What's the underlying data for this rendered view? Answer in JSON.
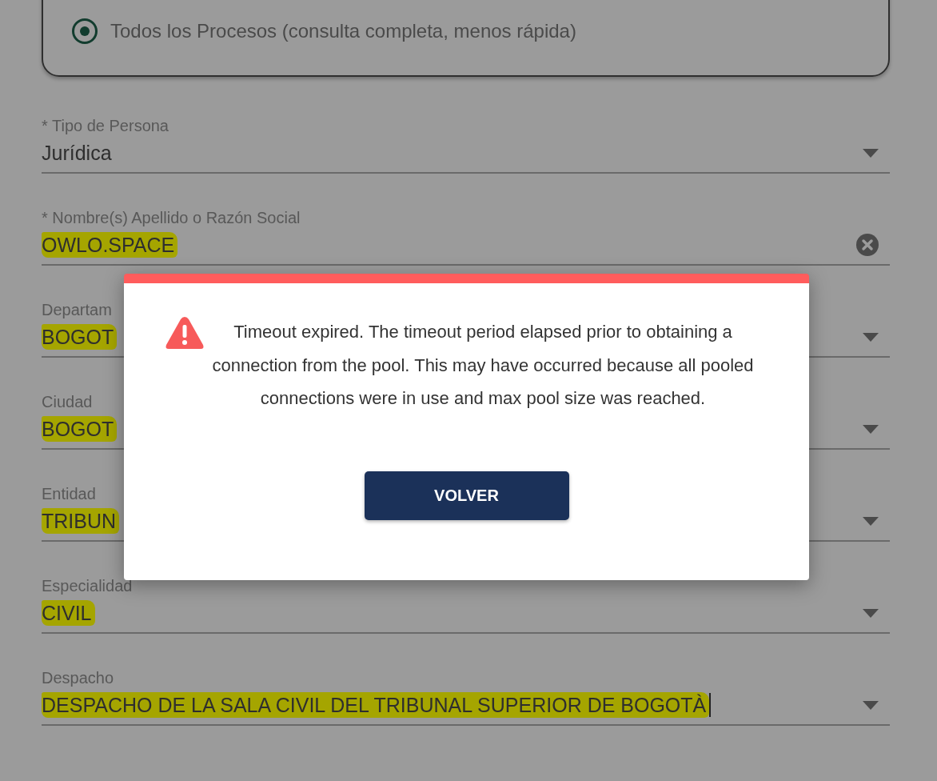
{
  "search_options": [
    {
      "label": "Todos los Procesos (consulta completa, menos rápida)",
      "selected": true
    }
  ],
  "fields": [
    {
      "label": "* Tipo de Persona",
      "value": "Jurídica",
      "kind": "dropdown",
      "highlighted": false,
      "cursor": false
    },
    {
      "label": "* Nombre(s) Apellido o Razón Social",
      "value": "OWLO.SPACE",
      "kind": "text",
      "highlighted": true,
      "cursor": false
    },
    {
      "label": "Departam",
      "value": "BOGOT",
      "kind": "dropdown",
      "highlighted": true,
      "cursor": false
    },
    {
      "label": "Ciudad",
      "value": "BOGOT",
      "kind": "dropdown",
      "highlighted": true,
      "cursor": false
    },
    {
      "label": "Entidad",
      "value": "TRIBUN",
      "kind": "dropdown",
      "highlighted": true,
      "cursor": false
    },
    {
      "label": "Especialidad",
      "value": "CIVIL",
      "kind": "dropdown",
      "highlighted": true,
      "cursor": false
    },
    {
      "label": "Despacho",
      "value": "DESPACHO DE LA SALA CIVIL DEL TRIBUNAL SUPERIOR DE BOGOTÀ",
      "kind": "dropdown",
      "highlighted": true,
      "cursor": true
    }
  ],
  "dialog": {
    "kind": "warning",
    "message": "Timeout expired. The timeout period elapsed prior to obtaining a connection from the pool. This may have occurred because all pooled connections were in use and max pool size was reached.",
    "button": "VOLVER"
  }
}
